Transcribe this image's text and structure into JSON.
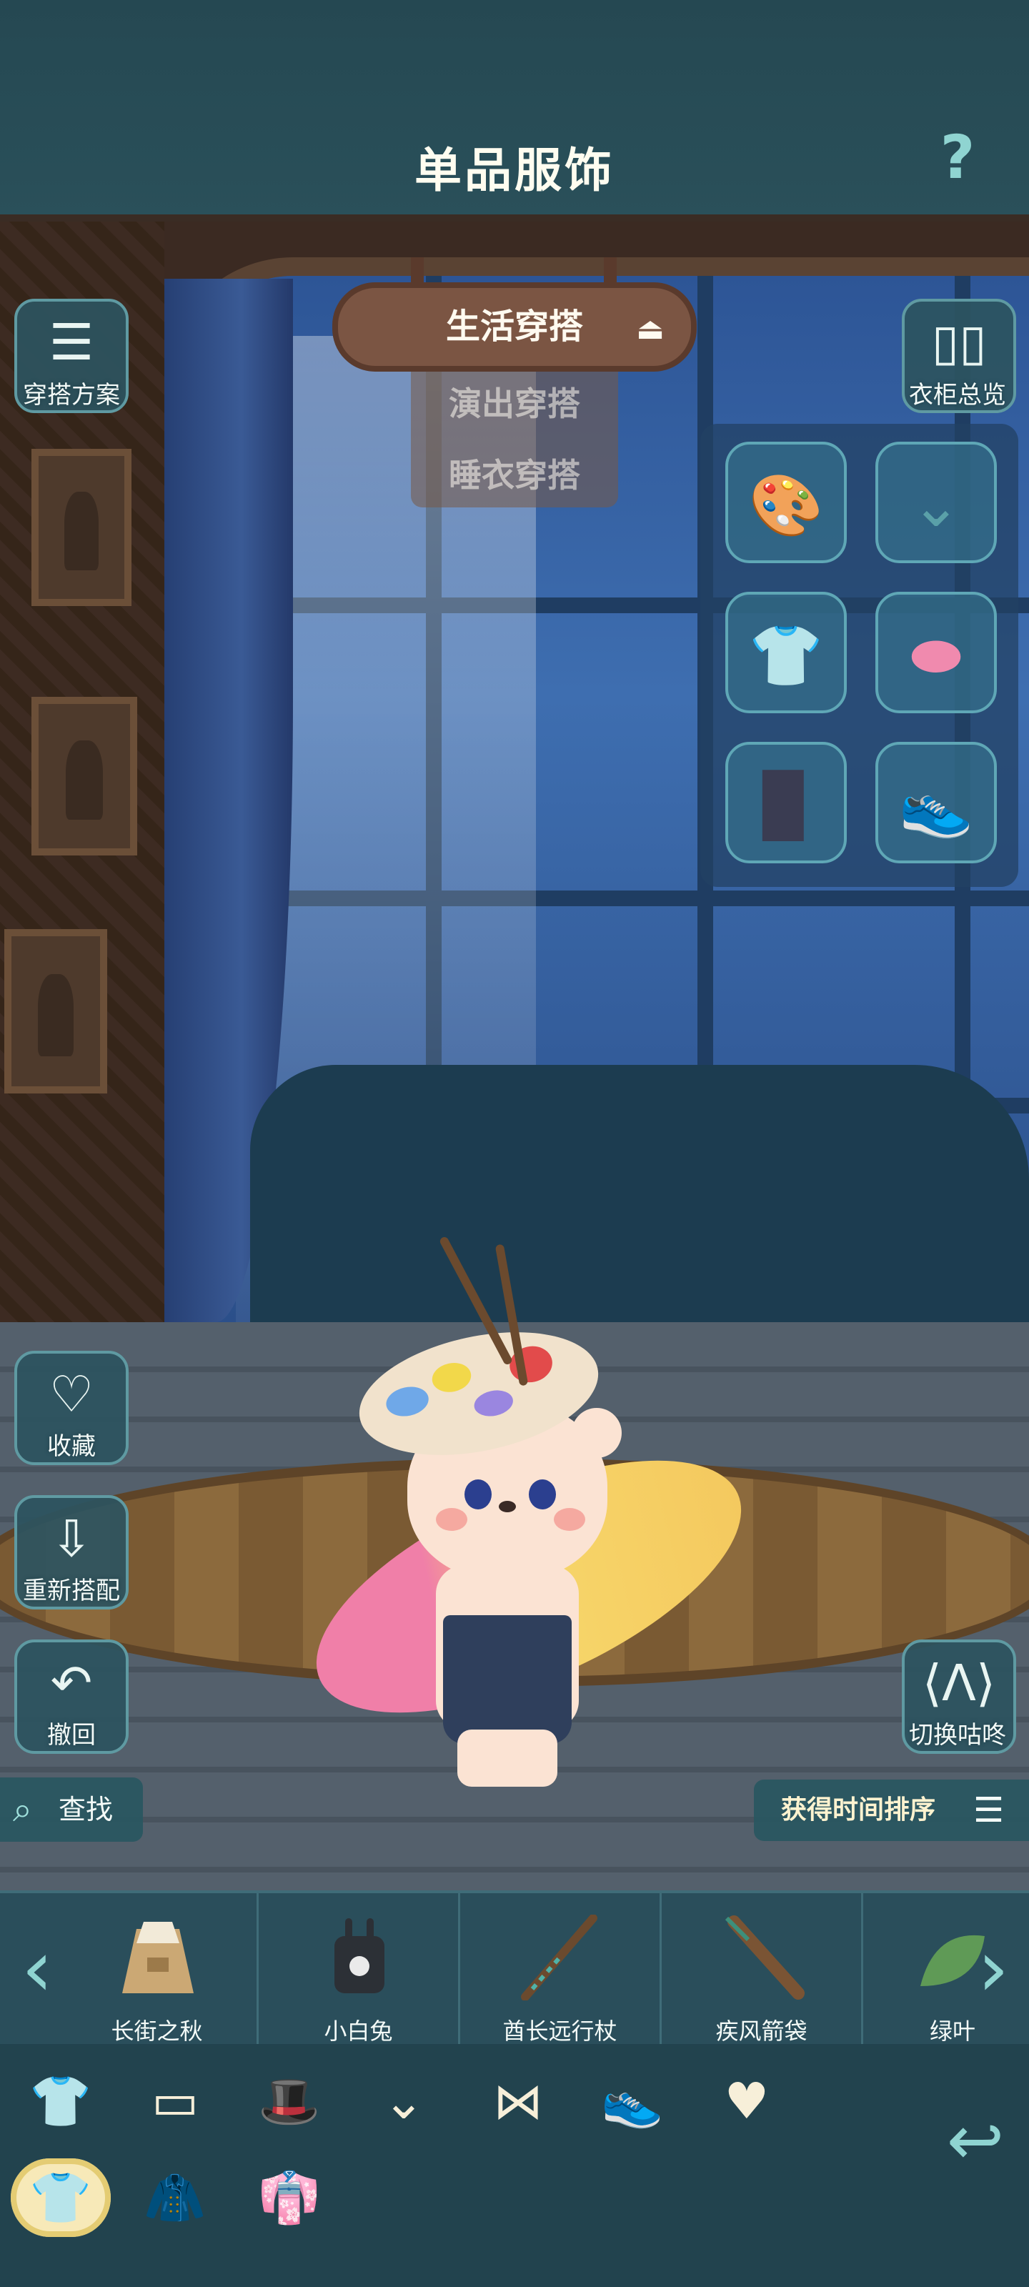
{
  "header": {
    "title": "单品服饰",
    "help_icon": "question-icon"
  },
  "outfit_selector": {
    "current": "生活穿搭",
    "toggle_icon": "eject-icon",
    "options": [
      "演出穿搭",
      "睡衣穿搭"
    ]
  },
  "left_buttons": [
    {
      "label": "穿搭方案",
      "icon": "outfit-plan-icon"
    },
    {
      "label": "收藏",
      "icon": "heart-icon"
    },
    {
      "label": "重新搭配",
      "icon": "rematch-icon"
    },
    {
      "label": "撤回",
      "icon": "undo-icon"
    }
  ],
  "right_buttons": [
    {
      "label": "衣柜总览",
      "icon": "wardrobe-icon"
    },
    {
      "label": "切换咕咚",
      "icon": "switch-character-icon"
    }
  ],
  "equipped_slots": [
    {
      "slot": "hat",
      "icon": "palette-hat-icon",
      "filled": true
    },
    {
      "slot": "accessory",
      "icon": "necklace-icon",
      "filled": false
    },
    {
      "slot": "top",
      "icon": "shirt-icon",
      "filled": false
    },
    {
      "slot": "handheld",
      "icon": "surfboard-icon",
      "filled": true
    },
    {
      "slot": "bottom",
      "icon": "overalls-icon",
      "filled": true
    },
    {
      "slot": "shoes",
      "icon": "shoe-icon",
      "filled": false
    }
  ],
  "search": {
    "label": "查找",
    "icon": "search-icon"
  },
  "sort": {
    "label": "获得时间排序",
    "icon": "sort-icon"
  },
  "items": [
    {
      "label": "长街之秋",
      "icon": "trench-coat-icon"
    },
    {
      "label": "小白兔",
      "icon": "bunny-hoodie-icon"
    },
    {
      "label": "酋长远行杖",
      "icon": "staff-icon"
    },
    {
      "label": "疾风箭袋",
      "icon": "quiver-icon"
    },
    {
      "label": "绿叶",
      "icon": "leaf-icon"
    }
  ],
  "category_icons": [
    "shirt-icon",
    "pants-icon",
    "hat-icon",
    "necklace-icon",
    "bow-icon",
    "shoe-icon",
    "heart-icon"
  ],
  "group_icons": [
    "clothing-group-icon",
    "outfit-group-icon",
    "set-group-icon"
  ],
  "colors": {
    "accent": "#8fd4d1",
    "panel": "#2a4e5b",
    "highlight": "#f7e9b8"
  }
}
